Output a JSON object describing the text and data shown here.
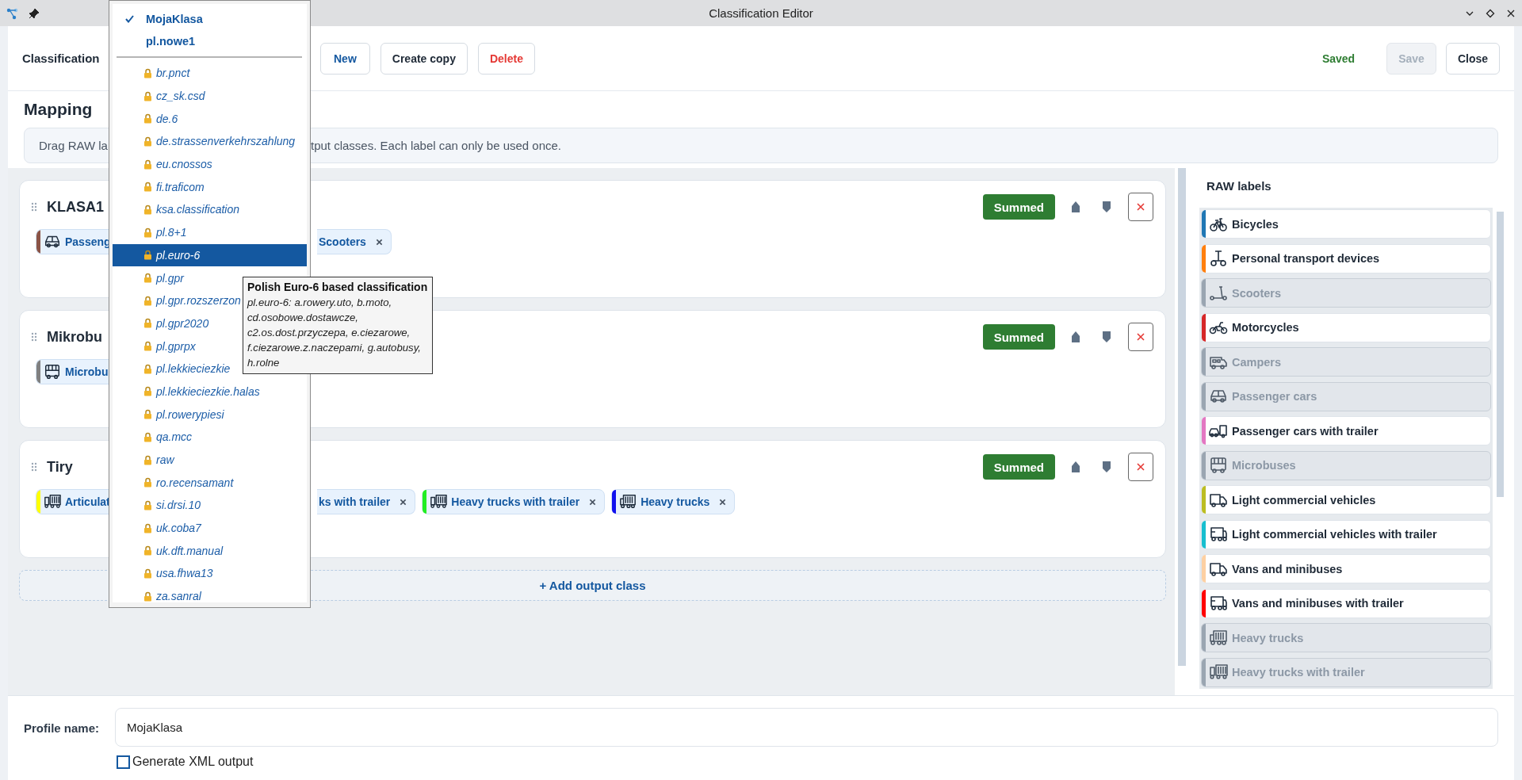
{
  "window": {
    "title": "Classification Editor"
  },
  "toolbar": {
    "label": "Classification",
    "buttons": [
      {
        "label": "New",
        "kind": "primary"
      },
      {
        "label": "Create copy",
        "kind": "default"
      },
      {
        "label": "Delete",
        "kind": "danger"
      }
    ],
    "status": "Saved",
    "save_button": {
      "label": "Save",
      "disabled": true
    },
    "close_button": {
      "label": "Close"
    }
  },
  "mapping": {
    "title": "Mapping",
    "hint_start": "Drag RAW la",
    "hint_end": "tput classes. Each label can only be used once."
  },
  "output_classes": [
    {
      "name": "KLASA1",
      "mode": "Summed",
      "chips_left": [
        {
          "label": "Passeng",
          "kind": "car",
          "color": "#8b5446"
        }
      ],
      "chips_right": [
        {
          "label": "Scooters"
        }
      ]
    },
    {
      "name": "Mikrobu",
      "mode": "Summed",
      "chips_left": [
        {
          "label": "Microbu",
          "kind": "bus",
          "color": "#808080"
        }
      ]
    },
    {
      "name": "Tiry",
      "mode": "Summed",
      "chips_left": [
        {
          "label": "Articulat",
          "kind": "truck-trailer",
          "color": "#ffff00"
        }
      ],
      "chips_right": [
        {
          "label": "ks with trailer"
        },
        {
          "label": "Heavy trucks with trailer",
          "kind": "truck-trailer",
          "color": "#22ee22"
        },
        {
          "label": "Heavy trucks",
          "kind": "truck",
          "color": "#1111ee"
        }
      ]
    }
  ],
  "add_class": {
    "label": "+ Add output class"
  },
  "raw_labels": {
    "title": "RAW labels",
    "items": [
      {
        "label": "Bicycles",
        "kind": "bicycle",
        "color": "#1f77b4",
        "used": false
      },
      {
        "label": "Personal transport devices",
        "kind": "transporter",
        "color": "#ff7f0e",
        "used": false
      },
      {
        "label": "Scooters",
        "kind": "scooter",
        "used": true
      },
      {
        "label": "Motorcycles",
        "kind": "motorcycle",
        "color": "#d62728",
        "used": false
      },
      {
        "label": "Campers",
        "kind": "camper",
        "used": true
      },
      {
        "label": "Passenger cars",
        "kind": "car",
        "used": true
      },
      {
        "label": "Passenger cars with trailer",
        "kind": "car-trailer",
        "color": "#e377c2",
        "used": false
      },
      {
        "label": "Microbuses",
        "kind": "bus",
        "used": true
      },
      {
        "label": "Light commercial vehicles",
        "kind": "van",
        "color": "#bcbd22",
        "used": false
      },
      {
        "label": "Light commercial vehicles with trailer",
        "kind": "van-trailer",
        "color": "#17becf",
        "used": false
      },
      {
        "label": "Vans and minibuses",
        "kind": "van",
        "color": "#fdd0a2",
        "used": false
      },
      {
        "label": "Vans and minibuses with trailer",
        "kind": "van-trailer",
        "color": "#ff0000",
        "used": false
      },
      {
        "label": "Heavy trucks",
        "kind": "truck",
        "used": true
      },
      {
        "label": "Heavy trucks with trailer",
        "kind": "truck-trailer",
        "used": true
      }
    ]
  },
  "profile": {
    "label": "Profile name:",
    "value": "MojaKlasa"
  },
  "xml_output": {
    "label": "Generate XML output",
    "checked": false
  },
  "profile_menu": {
    "user_profiles": [
      {
        "label": "MojaKlasa",
        "checked": true
      },
      {
        "label": "pl.nowe1",
        "checked": false
      }
    ],
    "builtin_profiles": [
      {
        "label": "br.pnct",
        "selected": false
      },
      {
        "label": "cz_sk.csd",
        "selected": false
      },
      {
        "label": "de.6",
        "selected": false
      },
      {
        "label": "de.strassenverkehrszahlung",
        "selected": false
      },
      {
        "label": "eu.cnossos",
        "selected": false
      },
      {
        "label": "fi.traficom",
        "selected": false
      },
      {
        "label": "ksa.classification",
        "selected": false
      },
      {
        "label": "pl.8+1",
        "selected": false
      },
      {
        "label": "pl.euro-6",
        "selected": true
      },
      {
        "label": "pl.gpr",
        "selected": false
      },
      {
        "label": "pl.gpr.rozszerzon",
        "selected": false
      },
      {
        "label": "pl.gpr2020",
        "selected": false
      },
      {
        "label": "pl.gprpx",
        "selected": false
      },
      {
        "label": "pl.lekkieciezkie",
        "selected": false
      },
      {
        "label": "pl.lekkieciezkie.halas",
        "selected": false
      },
      {
        "label": "pl.rowerypiesi",
        "selected": false
      },
      {
        "label": "qa.mcc",
        "selected": false
      },
      {
        "label": "raw",
        "selected": false
      },
      {
        "label": "ro.recensamant",
        "selected": false
      },
      {
        "label": "si.drsi.10",
        "selected": false
      },
      {
        "label": "uk.coba7",
        "selected": false
      },
      {
        "label": "uk.dft.manual",
        "selected": false
      },
      {
        "label": "usa.fhwa13",
        "selected": false
      },
      {
        "label": "za.sanral",
        "selected": false
      }
    ]
  },
  "tooltip": {
    "title": "Polish Euro-6 based classification",
    "text": "pl.euro-6: a.rowery.uto, b.moto, cd.osobowe.dostawcze, c2.os.dost.przyczepa, e.ciezarowe, f.ciezarowe.z.naczepami, g.autobusy, h.rolne"
  }
}
